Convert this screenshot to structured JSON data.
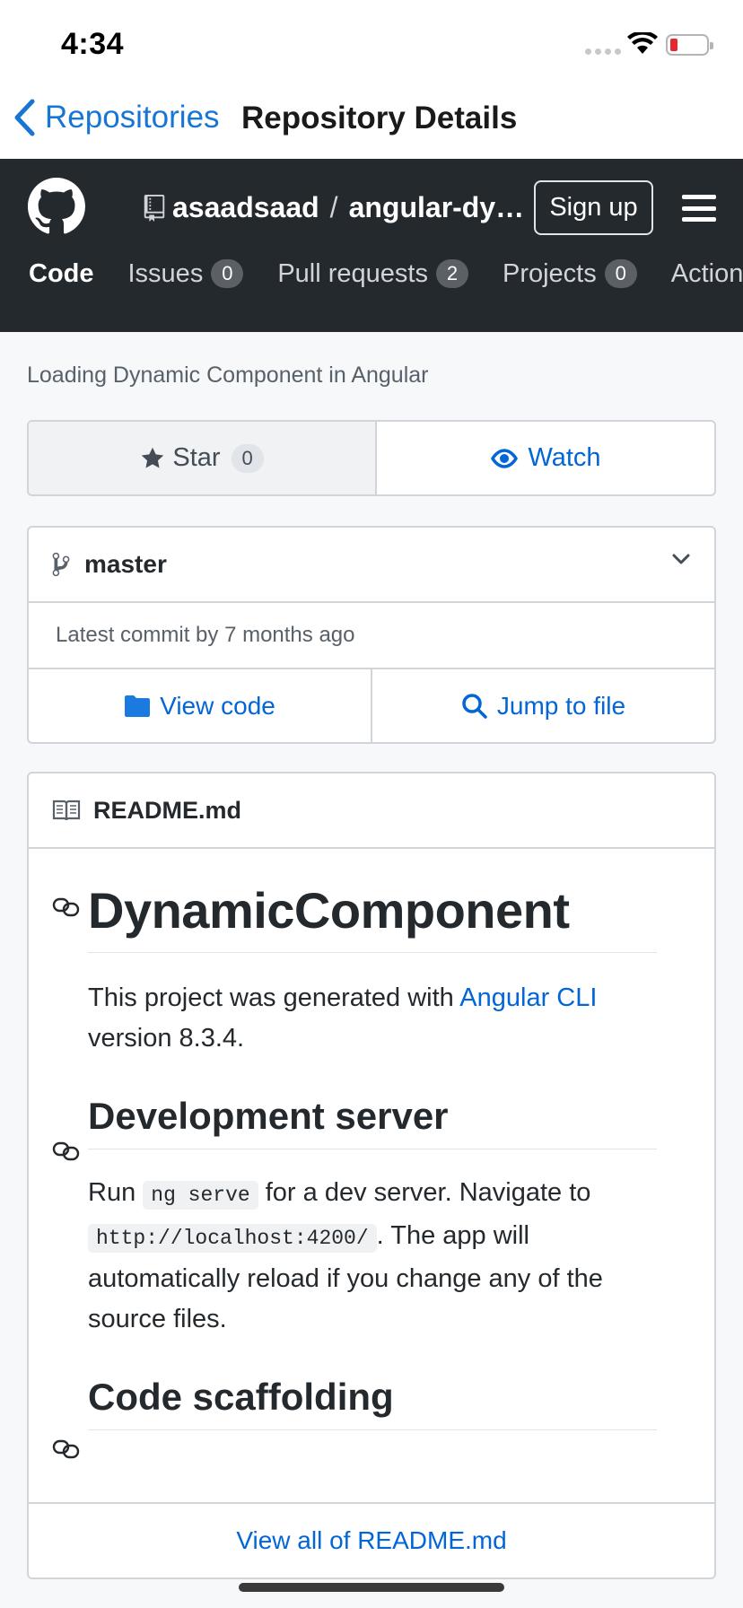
{
  "status": {
    "time": "4:34"
  },
  "nav": {
    "back_label": "Repositories",
    "title": "Repository Details"
  },
  "header": {
    "owner": "asaadsaad",
    "separator": "/",
    "repo": "angular-dy…",
    "signup_label": "Sign up",
    "tabs": [
      {
        "label": "Code",
        "count": null
      },
      {
        "label": "Issues",
        "count": "0"
      },
      {
        "label": "Pull requests",
        "count": "2"
      },
      {
        "label": "Projects",
        "count": "0"
      },
      {
        "label": "Action",
        "count": null
      }
    ]
  },
  "description": "Loading Dynamic Component in Angular",
  "star": {
    "label": "Star",
    "count": "0"
  },
  "watch": {
    "label": "Watch"
  },
  "branch": {
    "name": "master",
    "commit_text": "Latest commit by 7 months ago"
  },
  "actions": {
    "view_code": "View code",
    "jump_to_file": "Jump to file"
  },
  "readme": {
    "filename": "README.md",
    "h1": "DynamicComponent",
    "intro_text": "This project was generated with ",
    "intro_link": "Angular CLI",
    "intro_tail": " version 8.3.4.",
    "h2_dev": "Development server",
    "dev_run": "Run ",
    "dev_cmd": "ng serve",
    "dev_mid": " for a dev server. Navigate to ",
    "dev_url": "http://localhost:4200/",
    "dev_tail": ". The app will automatically reload if you change any of the source files.",
    "h2_scaffold": "Code scaffolding",
    "view_all": "View all of README.md"
  },
  "colors": {
    "accent": "#0366d6",
    "header_bg": "#24292e",
    "ios_blue": "#1776d4"
  }
}
